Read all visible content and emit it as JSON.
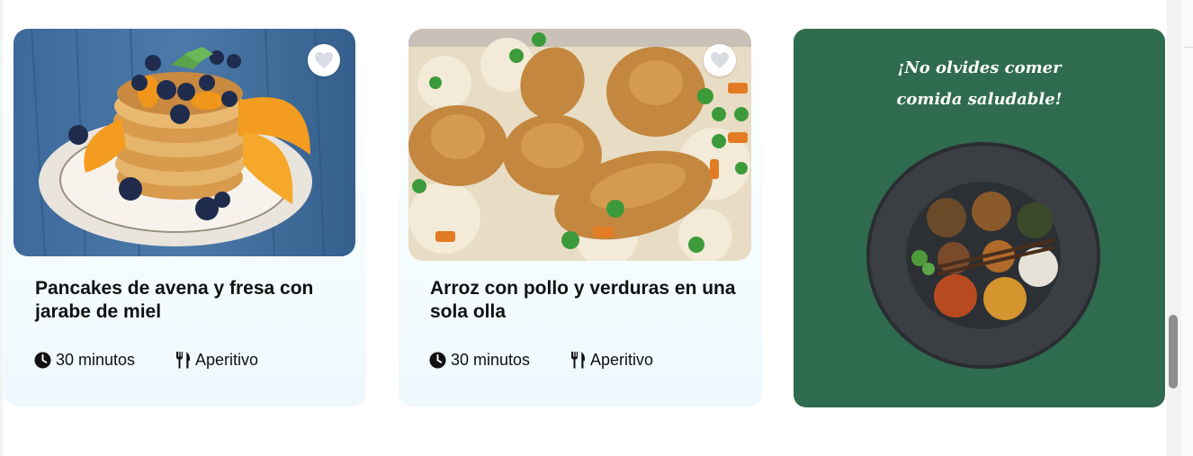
{
  "cards": [
    {
      "title": "Pancakes de avena y fresa con jarabe de miel",
      "time": "30 minutos",
      "category": "Aperitivo",
      "image": "pancakes-photo",
      "favorite_icon": "heart-icon"
    },
    {
      "title": "Arroz con pollo y verduras en una sola olla",
      "time": "30 minutos",
      "category": "Aperitivo",
      "image": "arroz-con-pollo-photo",
      "favorite_icon": "heart-icon"
    }
  ],
  "promo": {
    "line1": "¡No olvides comer",
    "line2": "comida saludable!",
    "background": "#2f6b4f",
    "image": "healthy-food-plate"
  },
  "icons": {
    "time": "clock-icon",
    "category": "utensils-icon"
  },
  "colors": {
    "card_bg": "#eef8fd",
    "promo_bg": "#2f6b4f",
    "heart": "#d9dde3"
  }
}
